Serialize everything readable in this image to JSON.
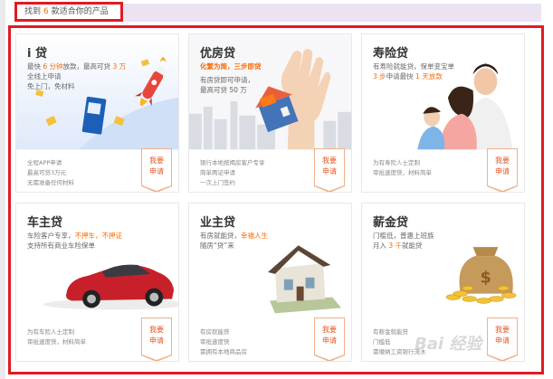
{
  "filter": {
    "prefix": "找到",
    "count": "6",
    "suffix": "款适合你的产品"
  },
  "colors": {
    "accent": "#ff6a00",
    "highlight_border": "#e21a22",
    "filter_bg": "#ebe3f2"
  },
  "cards": [
    {
      "title": "i 贷",
      "lines": [
        [
          "最快 ",
          "6 分钟",
          "放款，最高可贷 ",
          "3 万"
        ],
        [
          "全线上申请"
        ],
        [
          "免上门，免材料"
        ]
      ],
      "bottom": [
        "全程APP申请",
        "最高可贷3万元",
        "无需准备任何材料"
      ],
      "apply": [
        "我要",
        "申请"
      ],
      "icon": "rocket-icon"
    },
    {
      "title": "优房贷",
      "accent_line": "化繁为简，三步即贷",
      "lines": [
        [
          "有房贷即可申请，"
        ],
        [
          "最高可贷 50 万"
        ]
      ],
      "bottom": [
        "银行本地按揭房客户专享",
        "简单两证申请",
        "一次上门签约"
      ],
      "apply": [
        "我要",
        "申请"
      ],
      "icon": "house-hand-icon"
    },
    {
      "title": "寿险贷",
      "lines": [
        [
          "有寿险就能贷，保单变宝单"
        ],
        [
          "3 步",
          "申请最快 ",
          "1 天放款"
        ]
      ],
      "bottom": [
        "为有寿险人士定制",
        "审批速度快，材料简单"
      ],
      "apply": [
        "我要",
        "申请"
      ],
      "icon": "family-icon"
    },
    {
      "title": "车主贷",
      "lines": [
        [
          "车险客户专享，",
          "不押车，不押证"
        ],
        [
          "支持所有商业车险保单"
        ]
      ],
      "bottom": [
        "为有车险人士定制",
        "审批速度快，材料简单"
      ],
      "apply": [
        "我要",
        "申请"
      ],
      "icon": "car-icon"
    },
    {
      "title": "业主贷",
      "lines": [
        [
          "有房就能贷，",
          "幸福人生"
        ],
        [
          "随房“贷”来"
        ]
      ],
      "bottom": [
        "有房就能贷",
        "审批速度快",
        "需拥有本地商品房"
      ],
      "apply": [
        "我要",
        "申请"
      ],
      "icon": "house-icon"
    },
    {
      "title": "薪金贷",
      "lines": [
        [
          "门槛低，普惠上班族"
        ],
        [
          "月入 ",
          "3 千",
          "就能贷"
        ]
      ],
      "bottom": [
        "有薪金就能贷",
        "门槛低",
        "需缴纳工资银行流水"
      ],
      "apply": [
        "我要",
        "申请"
      ],
      "icon": "money-bag-icon"
    }
  ],
  "watermark": "Bai 经验"
}
